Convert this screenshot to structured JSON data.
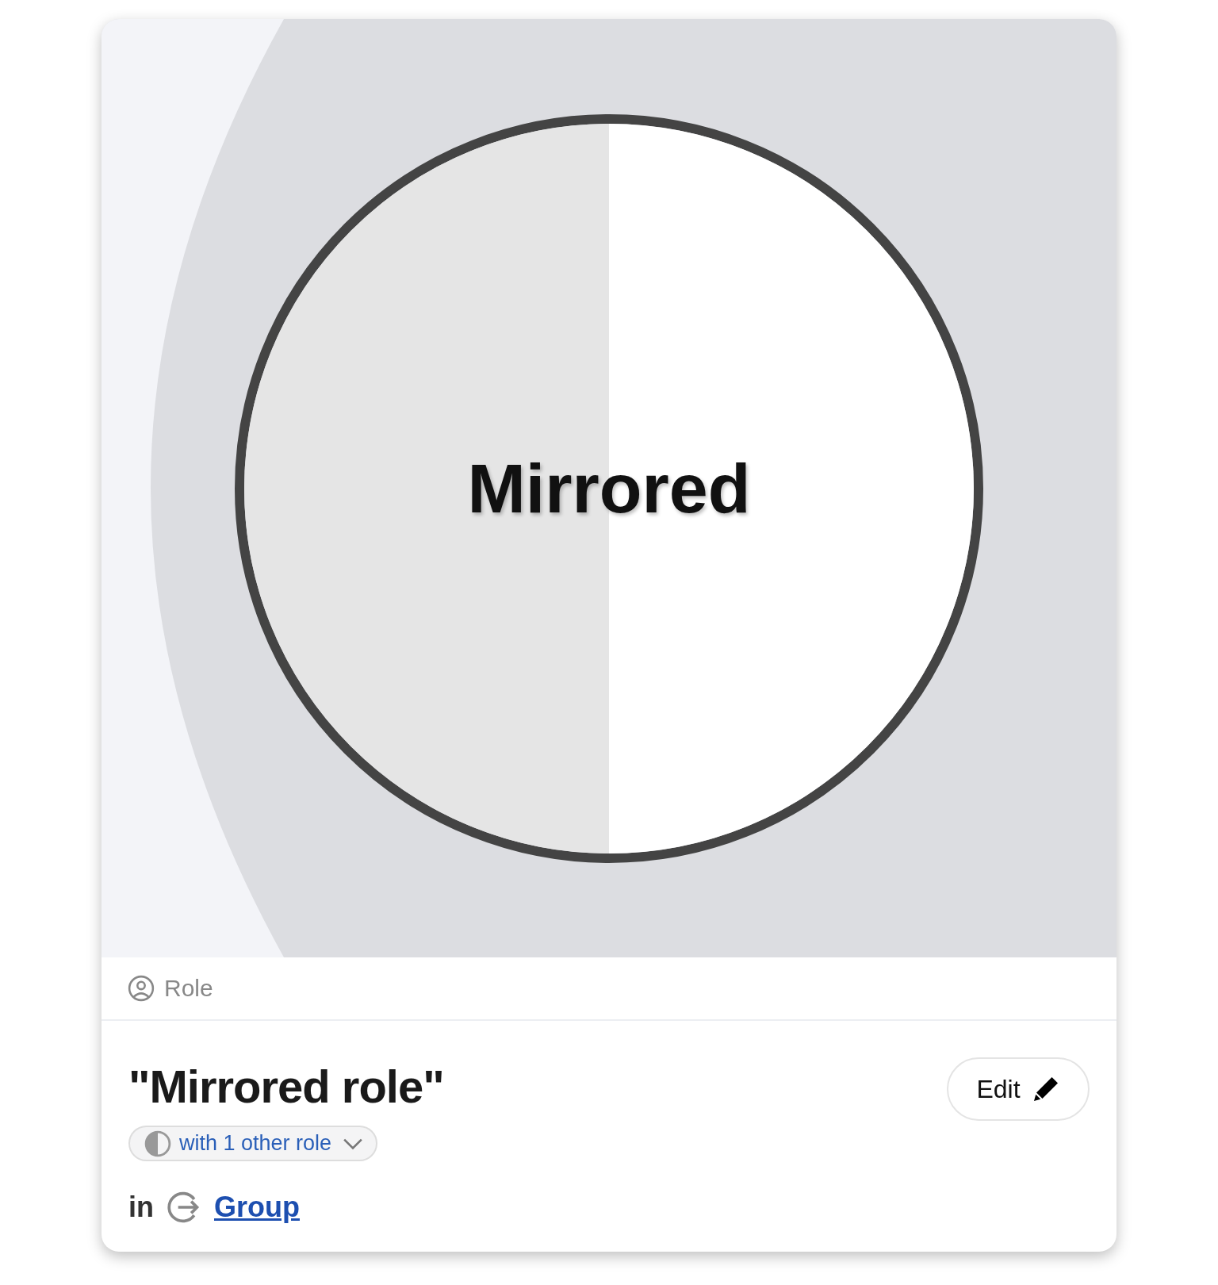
{
  "hero": {
    "label": "Mirrored"
  },
  "type_label": "Role",
  "title": "\"Mirrored role\"",
  "edit_button": "Edit",
  "relation_chip": {
    "label": "with 1 other role"
  },
  "location": {
    "prefix": "in",
    "link": "Group"
  }
}
